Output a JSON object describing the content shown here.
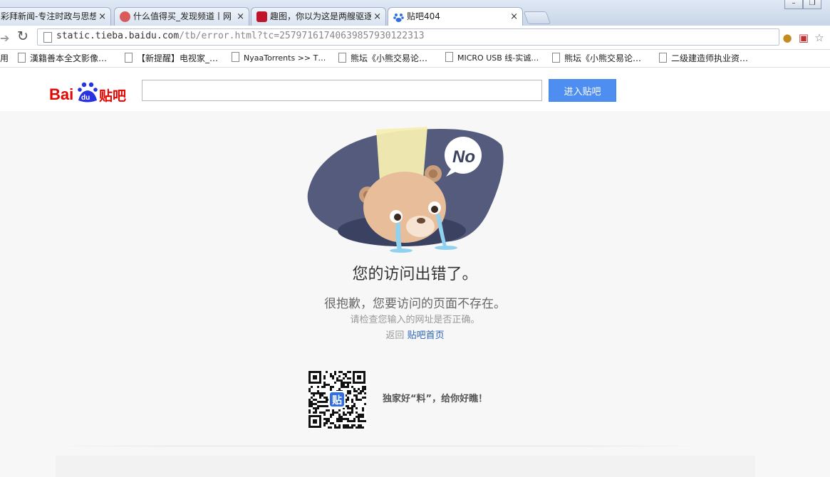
{
  "browser": {
    "tabs": [
      {
        "title": "彩拜新闻-专注时政与思想",
        "close": "×"
      },
      {
        "title": "什么值得买_发现频道丨网",
        "close": "×"
      },
      {
        "title": "趣图，你以为这是两艘驱逐",
        "close": "×"
      },
      {
        "title": "贴吧404",
        "close": "×"
      }
    ],
    "url": {
      "host": "static.tieba.baidu.com",
      "path": "/tb/error.html?tc=2579716174063985793012231З"
    },
    "bookmarks_prefix": "用",
    "bookmarks": [
      "漢籍善本全文影像…",
      "【新提醒】电视家_…",
      "NyaaTorrents >> T…",
      "熊坛《小熊交易论…",
      "MICRO USB 线-实诚…",
      "熊坛《小熊交易论…",
      "二级建造师执业资…"
    ]
  },
  "header": {
    "logo_text": "Baidu贴吧",
    "search_value": "",
    "search_button": "进入贴吧"
  },
  "error": {
    "bubble_text": "No",
    "title": "您的访问出错了。",
    "subtitle": "很抱歉，您要访问的页面不存在。",
    "hint": "请检查您输入的网址是否正确。",
    "return_prefix": "返回",
    "return_link": "贴吧首页"
  },
  "promo": {
    "qr_badge": "贴",
    "caption": "独家好“料”，给你好瞧！"
  },
  "colors": {
    "accent": "#4e8ef0",
    "logo_red": "#e10601",
    "logo_blue": "#2932e1",
    "link": "#2d64b3",
    "illustration_dark": "#545b7c"
  }
}
